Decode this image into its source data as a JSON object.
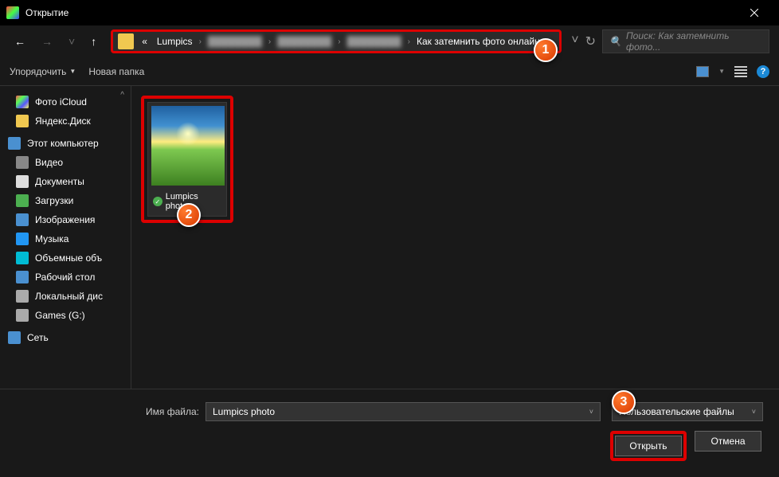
{
  "title": "Открытие",
  "breadcrumb": {
    "prefix": "«",
    "items": [
      "Lumpics",
      "",
      "Как затемнить фото онлайн"
    ]
  },
  "search": {
    "placeholder": "Поиск: Как затемнить фото..."
  },
  "toolbar": {
    "organize": "Упорядочить",
    "newfolder": "Новая папка"
  },
  "sidebar": {
    "icloud": "Фото iCloud",
    "yandex": "Яндекс.Диск",
    "thispc": "Этот компьютер",
    "video": "Видео",
    "documents": "Документы",
    "downloads": "Загрузки",
    "pictures": "Изображения",
    "music": "Музыка",
    "objects3d": "Объемные объ",
    "desktop": "Рабочий стол",
    "localdisk": "Локальный дис",
    "games": "Games (G:)",
    "network": "Сеть"
  },
  "file": {
    "name": "Lumpics photo"
  },
  "bottom": {
    "filenameLabel": "Имя файла:",
    "filenameValue": "Lumpics photo",
    "filetype": "Пользовательские файлы",
    "open": "Открыть",
    "cancel": "Отмена"
  },
  "callouts": {
    "c1": "1",
    "c2": "2",
    "c3": "3"
  }
}
